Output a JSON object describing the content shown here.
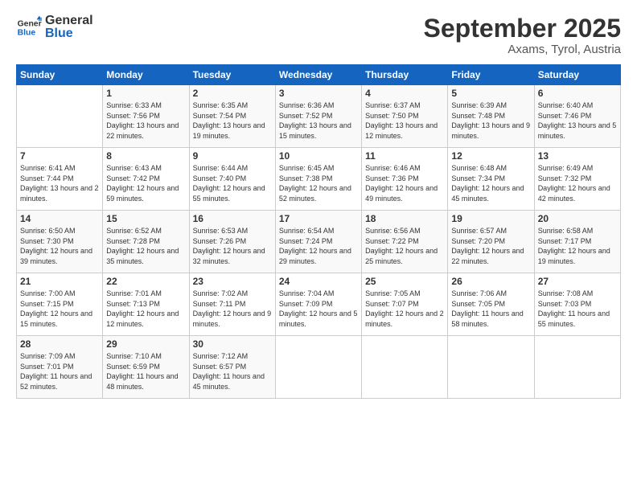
{
  "header": {
    "logo_general": "General",
    "logo_blue": "Blue",
    "month_title": "September 2025",
    "location": "Axams, Tyrol, Austria"
  },
  "weekdays": [
    "Sunday",
    "Monday",
    "Tuesday",
    "Wednesday",
    "Thursday",
    "Friday",
    "Saturday"
  ],
  "weeks": [
    [
      {
        "day": "",
        "sunrise": "",
        "sunset": "",
        "daylight": ""
      },
      {
        "day": "1",
        "sunrise": "6:33 AM",
        "sunset": "7:56 PM",
        "daylight": "13 hours and 22 minutes."
      },
      {
        "day": "2",
        "sunrise": "6:35 AM",
        "sunset": "7:54 PM",
        "daylight": "13 hours and 19 minutes."
      },
      {
        "day": "3",
        "sunrise": "6:36 AM",
        "sunset": "7:52 PM",
        "daylight": "13 hours and 15 minutes."
      },
      {
        "day": "4",
        "sunrise": "6:37 AM",
        "sunset": "7:50 PM",
        "daylight": "13 hours and 12 minutes."
      },
      {
        "day": "5",
        "sunrise": "6:39 AM",
        "sunset": "7:48 PM",
        "daylight": "13 hours and 9 minutes."
      },
      {
        "day": "6",
        "sunrise": "6:40 AM",
        "sunset": "7:46 PM",
        "daylight": "13 hours and 5 minutes."
      }
    ],
    [
      {
        "day": "7",
        "sunrise": "6:41 AM",
        "sunset": "7:44 PM",
        "daylight": "13 hours and 2 minutes."
      },
      {
        "day": "8",
        "sunrise": "6:43 AM",
        "sunset": "7:42 PM",
        "daylight": "12 hours and 59 minutes."
      },
      {
        "day": "9",
        "sunrise": "6:44 AM",
        "sunset": "7:40 PM",
        "daylight": "12 hours and 55 minutes."
      },
      {
        "day": "10",
        "sunrise": "6:45 AM",
        "sunset": "7:38 PM",
        "daylight": "12 hours and 52 minutes."
      },
      {
        "day": "11",
        "sunrise": "6:46 AM",
        "sunset": "7:36 PM",
        "daylight": "12 hours and 49 minutes."
      },
      {
        "day": "12",
        "sunrise": "6:48 AM",
        "sunset": "7:34 PM",
        "daylight": "12 hours and 45 minutes."
      },
      {
        "day": "13",
        "sunrise": "6:49 AM",
        "sunset": "7:32 PM",
        "daylight": "12 hours and 42 minutes."
      }
    ],
    [
      {
        "day": "14",
        "sunrise": "6:50 AM",
        "sunset": "7:30 PM",
        "daylight": "12 hours and 39 minutes."
      },
      {
        "day": "15",
        "sunrise": "6:52 AM",
        "sunset": "7:28 PM",
        "daylight": "12 hours and 35 minutes."
      },
      {
        "day": "16",
        "sunrise": "6:53 AM",
        "sunset": "7:26 PM",
        "daylight": "12 hours and 32 minutes."
      },
      {
        "day": "17",
        "sunrise": "6:54 AM",
        "sunset": "7:24 PM",
        "daylight": "12 hours and 29 minutes."
      },
      {
        "day": "18",
        "sunrise": "6:56 AM",
        "sunset": "7:22 PM",
        "daylight": "12 hours and 25 minutes."
      },
      {
        "day": "19",
        "sunrise": "6:57 AM",
        "sunset": "7:20 PM",
        "daylight": "12 hours and 22 minutes."
      },
      {
        "day": "20",
        "sunrise": "6:58 AM",
        "sunset": "7:17 PM",
        "daylight": "12 hours and 19 minutes."
      }
    ],
    [
      {
        "day": "21",
        "sunrise": "7:00 AM",
        "sunset": "7:15 PM",
        "daylight": "12 hours and 15 minutes."
      },
      {
        "day": "22",
        "sunrise": "7:01 AM",
        "sunset": "7:13 PM",
        "daylight": "12 hours and 12 minutes."
      },
      {
        "day": "23",
        "sunrise": "7:02 AM",
        "sunset": "7:11 PM",
        "daylight": "12 hours and 9 minutes."
      },
      {
        "day": "24",
        "sunrise": "7:04 AM",
        "sunset": "7:09 PM",
        "daylight": "12 hours and 5 minutes."
      },
      {
        "day": "25",
        "sunrise": "7:05 AM",
        "sunset": "7:07 PM",
        "daylight": "12 hours and 2 minutes."
      },
      {
        "day": "26",
        "sunrise": "7:06 AM",
        "sunset": "7:05 PM",
        "daylight": "11 hours and 58 minutes."
      },
      {
        "day": "27",
        "sunrise": "7:08 AM",
        "sunset": "7:03 PM",
        "daylight": "11 hours and 55 minutes."
      }
    ],
    [
      {
        "day": "28",
        "sunrise": "7:09 AM",
        "sunset": "7:01 PM",
        "daylight": "11 hours and 52 minutes."
      },
      {
        "day": "29",
        "sunrise": "7:10 AM",
        "sunset": "6:59 PM",
        "daylight": "11 hours and 48 minutes."
      },
      {
        "day": "30",
        "sunrise": "7:12 AM",
        "sunset": "6:57 PM",
        "daylight": "11 hours and 45 minutes."
      },
      {
        "day": "",
        "sunrise": "",
        "sunset": "",
        "daylight": ""
      },
      {
        "day": "",
        "sunrise": "",
        "sunset": "",
        "daylight": ""
      },
      {
        "day": "",
        "sunrise": "",
        "sunset": "",
        "daylight": ""
      },
      {
        "day": "",
        "sunrise": "",
        "sunset": "",
        "daylight": ""
      }
    ]
  ],
  "labels": {
    "sunrise_prefix": "Sunrise: ",
    "sunset_prefix": "Sunset: ",
    "daylight_prefix": "Daylight: "
  }
}
